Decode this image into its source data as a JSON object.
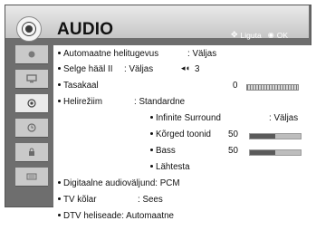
{
  "header": {
    "title": "AUDIO",
    "hint_move": "Liguta",
    "hint_ok": "OK"
  },
  "sidebar": {
    "items": [
      {
        "icon": "picture-icon"
      },
      {
        "icon": "tv-icon"
      },
      {
        "icon": "audio-icon",
        "active": true
      },
      {
        "icon": "clock-icon"
      },
      {
        "icon": "lock-icon"
      },
      {
        "icon": "keyboard-icon"
      }
    ]
  },
  "menu": {
    "auto_volume": {
      "label": "Automaatne helitugevus",
      "value": ": Väljas"
    },
    "clear_voice": {
      "label": "Selge hääl II",
      "value": ": Väljas",
      "level": "3"
    },
    "balance": {
      "label": "Tasakaal",
      "value": "0"
    },
    "sound_mode": {
      "label": "Helirežiim",
      "value": ": Standardne"
    },
    "infinite_surround": {
      "label": "Infinite Surround",
      "value": ": Väljas"
    },
    "treble": {
      "label": "Kõrged toonid",
      "value": "50",
      "fraction": 0.5
    },
    "bass": {
      "label": "Bass",
      "value": "50",
      "fraction": 0.5
    },
    "reset": {
      "label": "Lähtesta"
    },
    "digital_output": {
      "label": "Digitaalne audioväljund: PCM"
    },
    "tv_speaker": {
      "label": "TV kõlar",
      "value": ": Sees"
    },
    "dtv_audio": {
      "label": "DTV heliseade: Automaatne"
    }
  },
  "colors": {
    "frame": "#6e6e6e",
    "header": "#d8d8d8",
    "panel": "#ffffff"
  }
}
